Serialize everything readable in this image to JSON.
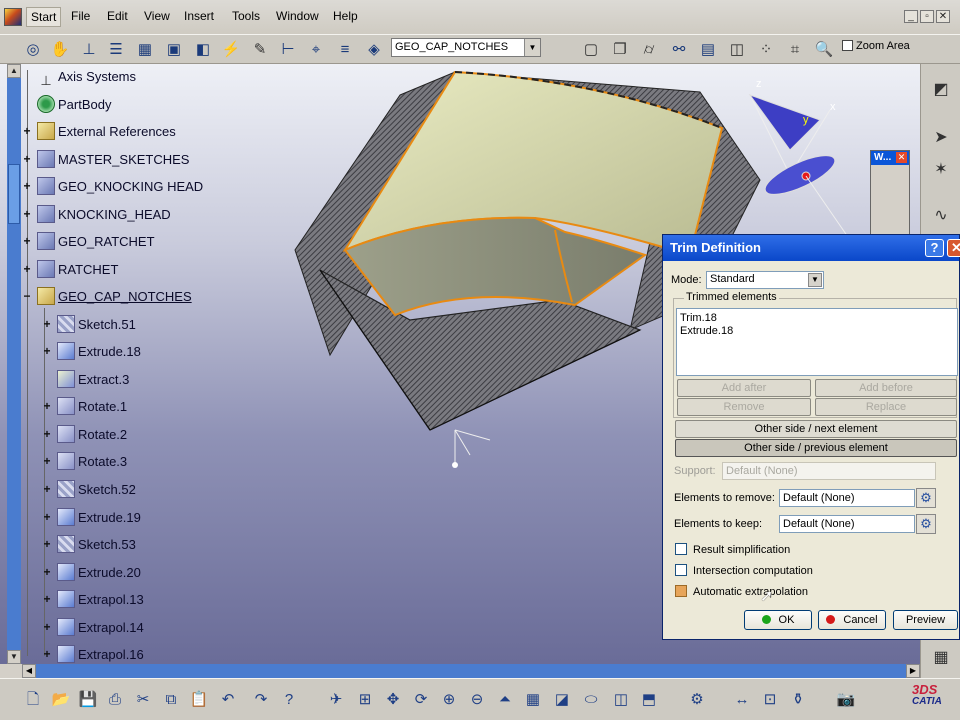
{
  "menu": {
    "items": [
      {
        "label": "Start",
        "active": true
      },
      {
        "label": "File"
      },
      {
        "label": "Edit"
      },
      {
        "label": "View"
      },
      {
        "label": "Insert"
      },
      {
        "label": "Tools"
      },
      {
        "label": "Window"
      },
      {
        "label": "Help"
      }
    ]
  },
  "toolbar": {
    "current_layer": "GEO_CAP_NOTCHES",
    "zoom_area_label": "Zoom Area"
  },
  "tree": {
    "items": [
      {
        "label": "Axis Systems",
        "icon": "axis-system-icon"
      },
      {
        "label": "PartBody",
        "icon": "partbody-gear-icon"
      },
      {
        "label": "External References",
        "icon": "external-references-icon"
      },
      {
        "label": "MASTER_SKETCHES",
        "icon": "geometrical-set-icon"
      },
      {
        "label": "GEO_KNOCKING HEAD",
        "icon": "geometrical-set-icon"
      },
      {
        "label": "KNOCKING_HEAD",
        "icon": "geometrical-set-icon"
      },
      {
        "label": "GEO_RATCHET",
        "icon": "geometrical-set-icon"
      },
      {
        "label": "RATCHET",
        "icon": "geometrical-set-icon"
      },
      {
        "label": "GEO_CAP_NOTCHES",
        "icon": "external-references-icon",
        "selected": true
      },
      {
        "label": "Sketch.51",
        "icon": "sketch-icon"
      },
      {
        "label": "Extrude.18",
        "icon": "extrude-icon"
      },
      {
        "label": "Extract.3",
        "icon": "extract-icon"
      },
      {
        "label": "Rotate.1",
        "icon": "rotate-icon"
      },
      {
        "label": "Rotate.2",
        "icon": "rotate-icon"
      },
      {
        "label": "Rotate.3",
        "icon": "rotate-icon"
      },
      {
        "label": "Sketch.52",
        "icon": "sketch-icon"
      },
      {
        "label": "Extrude.19",
        "icon": "extrude-icon"
      },
      {
        "label": "Sketch.53",
        "icon": "sketch-icon"
      },
      {
        "label": "Extrude.20",
        "icon": "extrude-icon"
      },
      {
        "label": "Extrapol.13",
        "icon": "extrapolate-icon"
      },
      {
        "label": "Extrapol.14",
        "icon": "extrapolate-icon"
      },
      {
        "label": "Extrapol.16",
        "icon": "extrapolate-icon"
      }
    ]
  },
  "mini_panel": {
    "title": "W..."
  },
  "compass": {
    "z": "z",
    "x": "x",
    "y": "y"
  },
  "dialog": {
    "title": "Trim Definition",
    "help": "?",
    "close": "✕",
    "mode_label": "Mode:",
    "mode_value": "Standard",
    "trimmed_group_label": "Trimmed elements",
    "trimmed_elements": [
      "Trim.18",
      "Extrude.18"
    ],
    "add_after": "Add after",
    "add_before": "Add before",
    "remove": "Remove",
    "replace": "Replace",
    "other_side_next": "Other side / next element",
    "other_side_previous": "Other side / previous element",
    "support_label": "Support:",
    "support_value": "Default (None)",
    "remove_label": "Elements to remove:",
    "remove_value": "Default (None)",
    "keep_label": "Elements to keep:",
    "keep_value": "Default (None)",
    "result_simplification": "Result simplification",
    "intersection_computation": "Intersection computation",
    "automatic_extrapolation": "Automatic extrapolation",
    "result_simplification_checked": false,
    "intersection_computation_checked": false,
    "automatic_extrapolation_checked": true,
    "ok": "OK",
    "cancel": "Cancel",
    "preview": "Preview"
  },
  "brand": {
    "logo_text": "CATIA",
    "ds": "3DS"
  }
}
